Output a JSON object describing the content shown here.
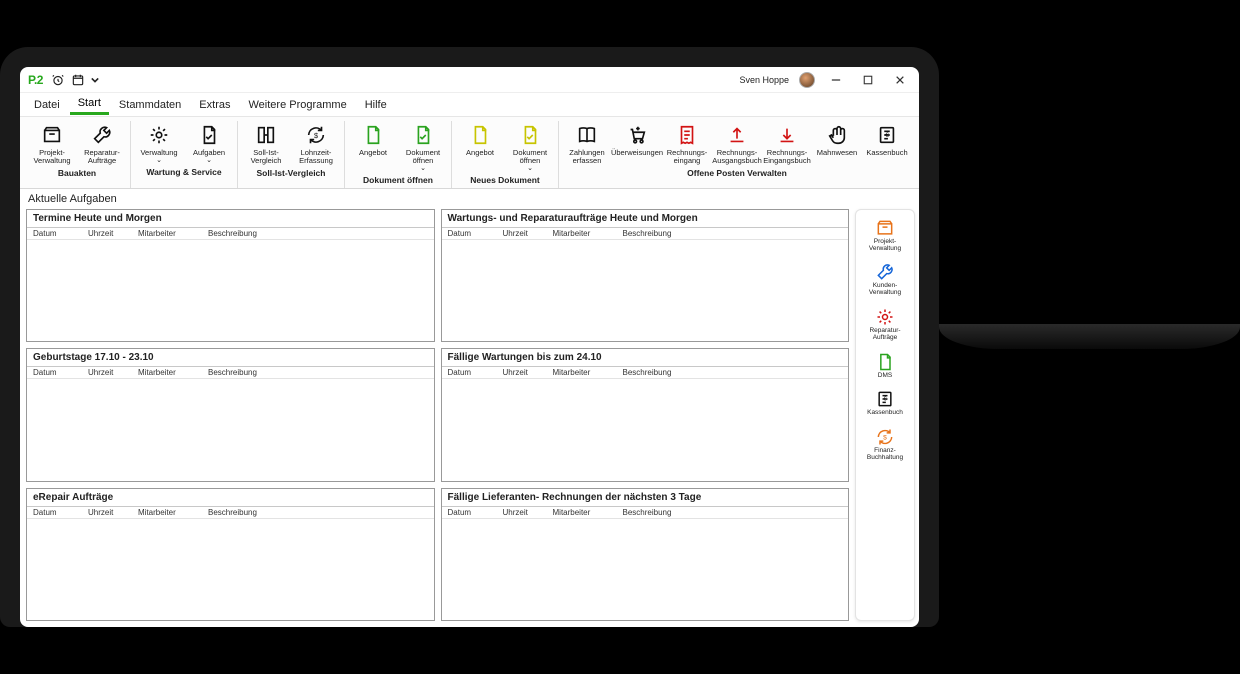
{
  "header": {
    "logo": "P.2",
    "user": "Sven Hoppe"
  },
  "menu": [
    "Datei",
    "Start",
    "Stammdaten",
    "Extras",
    "Weitere Programme",
    "Hilfe"
  ],
  "menu_active_index": 1,
  "ribbon": {
    "groups": [
      {
        "label": "Bauakten",
        "items": [
          {
            "name": "projekt-verwaltung",
            "label": "Projekt-\nVerwaltung",
            "icon": "box-black"
          },
          {
            "name": "reparatur-auftraege",
            "label": "Reparatur-\nAufträge",
            "icon": "wrench-black"
          }
        ]
      },
      {
        "label": "Wartung & Service",
        "items": [
          {
            "name": "verwaltung",
            "label": "Verwaltung",
            "icon": "gear-black",
            "chevron": true
          },
          {
            "name": "aufgaben",
            "label": "Aufgaben",
            "icon": "doc-check-black",
            "chevron": true
          }
        ]
      },
      {
        "label": "Soll-Ist-Vergleich",
        "items": [
          {
            "name": "soll-ist-vergleich",
            "label": "Soll-Ist-\nVergleich",
            "icon": "compare-black"
          },
          {
            "name": "lohnzeit-erfassung",
            "label": "Lohnzeit-Erfassung",
            "icon": "refresh-dollar-black"
          }
        ]
      },
      {
        "label": "Dokument öffnen",
        "items": [
          {
            "name": "angebot-oeffnen",
            "label": "Angebot",
            "icon": "doc-green"
          },
          {
            "name": "dokument-oeffnen",
            "label": "Dokument\nöffnen",
            "icon": "doc-check-green",
            "chevron": true
          }
        ]
      },
      {
        "label": "Neues Dokument",
        "items": [
          {
            "name": "angebot-neu",
            "label": "Angebot",
            "icon": "doc-yellow"
          },
          {
            "name": "dokument-oeffnen-neu",
            "label": "Dokument\nöffnen",
            "icon": "doc-check-yellow",
            "chevron": true
          }
        ]
      },
      {
        "label": "Offene Posten Verwalten",
        "items": [
          {
            "name": "zahlungen-erfassen",
            "label": "Zahlungen\nerfassen",
            "icon": "book-black"
          },
          {
            "name": "ueberweisungen",
            "label": "Überweisungen",
            "icon": "cart-black"
          },
          {
            "name": "rechnungs-eingang",
            "label": "Rechnungs-\neingang",
            "icon": "receipt-red"
          },
          {
            "name": "rechnungs-ausgangsbuch",
            "label": "Rechnungs-\nAusgangsbuch",
            "icon": "upload-red"
          },
          {
            "name": "rechnungs-eingangsbuch",
            "label": "Rechnungs-\nEingangsbuch",
            "icon": "download-red"
          },
          {
            "name": "mahnwesen",
            "label": "Mahnwesen",
            "icon": "hand-black"
          },
          {
            "name": "kassenbuch",
            "label": "Kassenbuch",
            "icon": "ledger-black"
          }
        ]
      }
    ]
  },
  "page_title": "Aktuelle Aufgaben",
  "columns": {
    "date": "Datum",
    "time": "Uhrzeit",
    "employee": "Mitarbeiter",
    "description": "Beschreibung"
  },
  "panels": [
    "Termine Heute und Morgen",
    "Wartungs- und Reparaturaufträge Heute und Morgen",
    "Geburtstage 17.10 - 23.10",
    "Fällige Wartungen bis zum 24.10",
    "eRepair Aufträge",
    "Fällige Lieferanten- Rechnungen der nächsten 3 Tage"
  ],
  "sidebar": [
    {
      "name": "sb-projekt",
      "label": "Projekt-\nVerwaltung",
      "icon": "box-orange"
    },
    {
      "name": "sb-kunden",
      "label": "Kunden-\nVerwaltung",
      "icon": "wrench-blue"
    },
    {
      "name": "sb-reparatur",
      "label": "Reparatur-\nAufträge",
      "icon": "gear-red"
    },
    {
      "name": "sb-dms",
      "label": "DMS",
      "icon": "doc-green"
    },
    {
      "name": "sb-kassenbuch",
      "label": "Kassenbuch",
      "icon": "ledger-black"
    },
    {
      "name": "sb-finanz",
      "label": "Finanz-\nBuchhaltung",
      "icon": "refresh-dollar-orange"
    }
  ]
}
